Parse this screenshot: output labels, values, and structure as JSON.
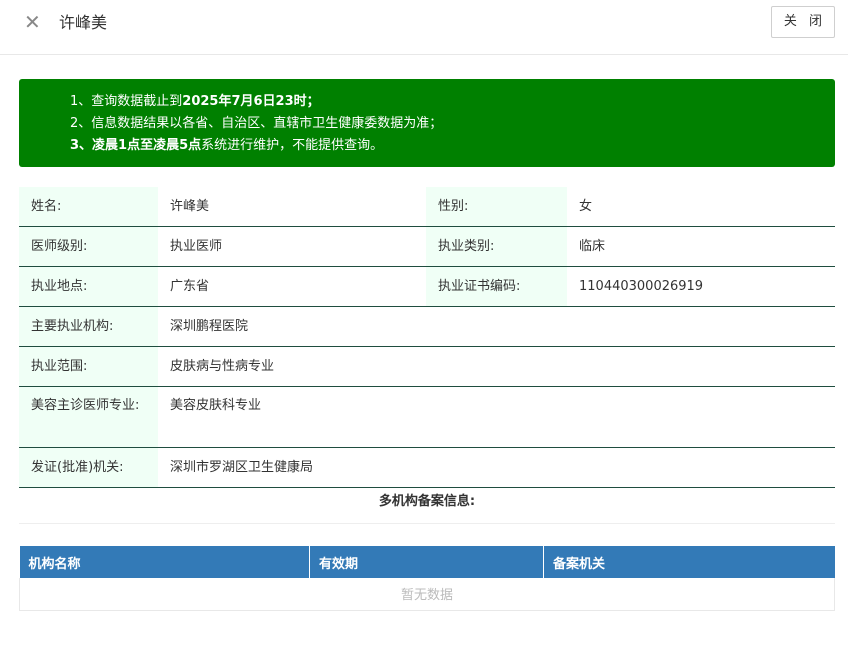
{
  "header": {
    "title": "许峰美",
    "close_label": "关 闭"
  },
  "notice": {
    "line1_pre": "1、查询数据截止到",
    "line1_bold": "2025年7月6日23时；",
    "line2": "2、信息数据结果以各省、自治区、直辖市卫生健康委数据为准；",
    "line3_bold": "3、凌晨1点至凌晨5点",
    "line3_post": "系统进行维护，不能提供查询。"
  },
  "info": {
    "name_label": "姓名:",
    "name": "许峰美",
    "gender_label": "性别:",
    "gender": "女",
    "level_label": "医师级别:",
    "level": "执业医师",
    "category_label": "执业类别:",
    "category": "临床",
    "location_label": "执业地点:",
    "location": "广东省",
    "cert_label": "执业证书编码:",
    "cert": "110440300026919",
    "institution_label": "主要执业机构:",
    "institution": "深圳鹏程医院",
    "scope_label": "执业范围:",
    "scope": "皮肤病与性病专业",
    "cosmetic_label": "美容主诊医师专业:",
    "cosmetic": "美容皮肤科专业",
    "issuer_label": "发证(批准)机关:",
    "issuer": "深圳市罗湖区卫生健康局"
  },
  "multi": {
    "title": "多机构备案信息:"
  },
  "org_table": {
    "headers": [
      "机构名称",
      "有效期",
      "备案机关"
    ],
    "empty": "暂无数据"
  }
}
